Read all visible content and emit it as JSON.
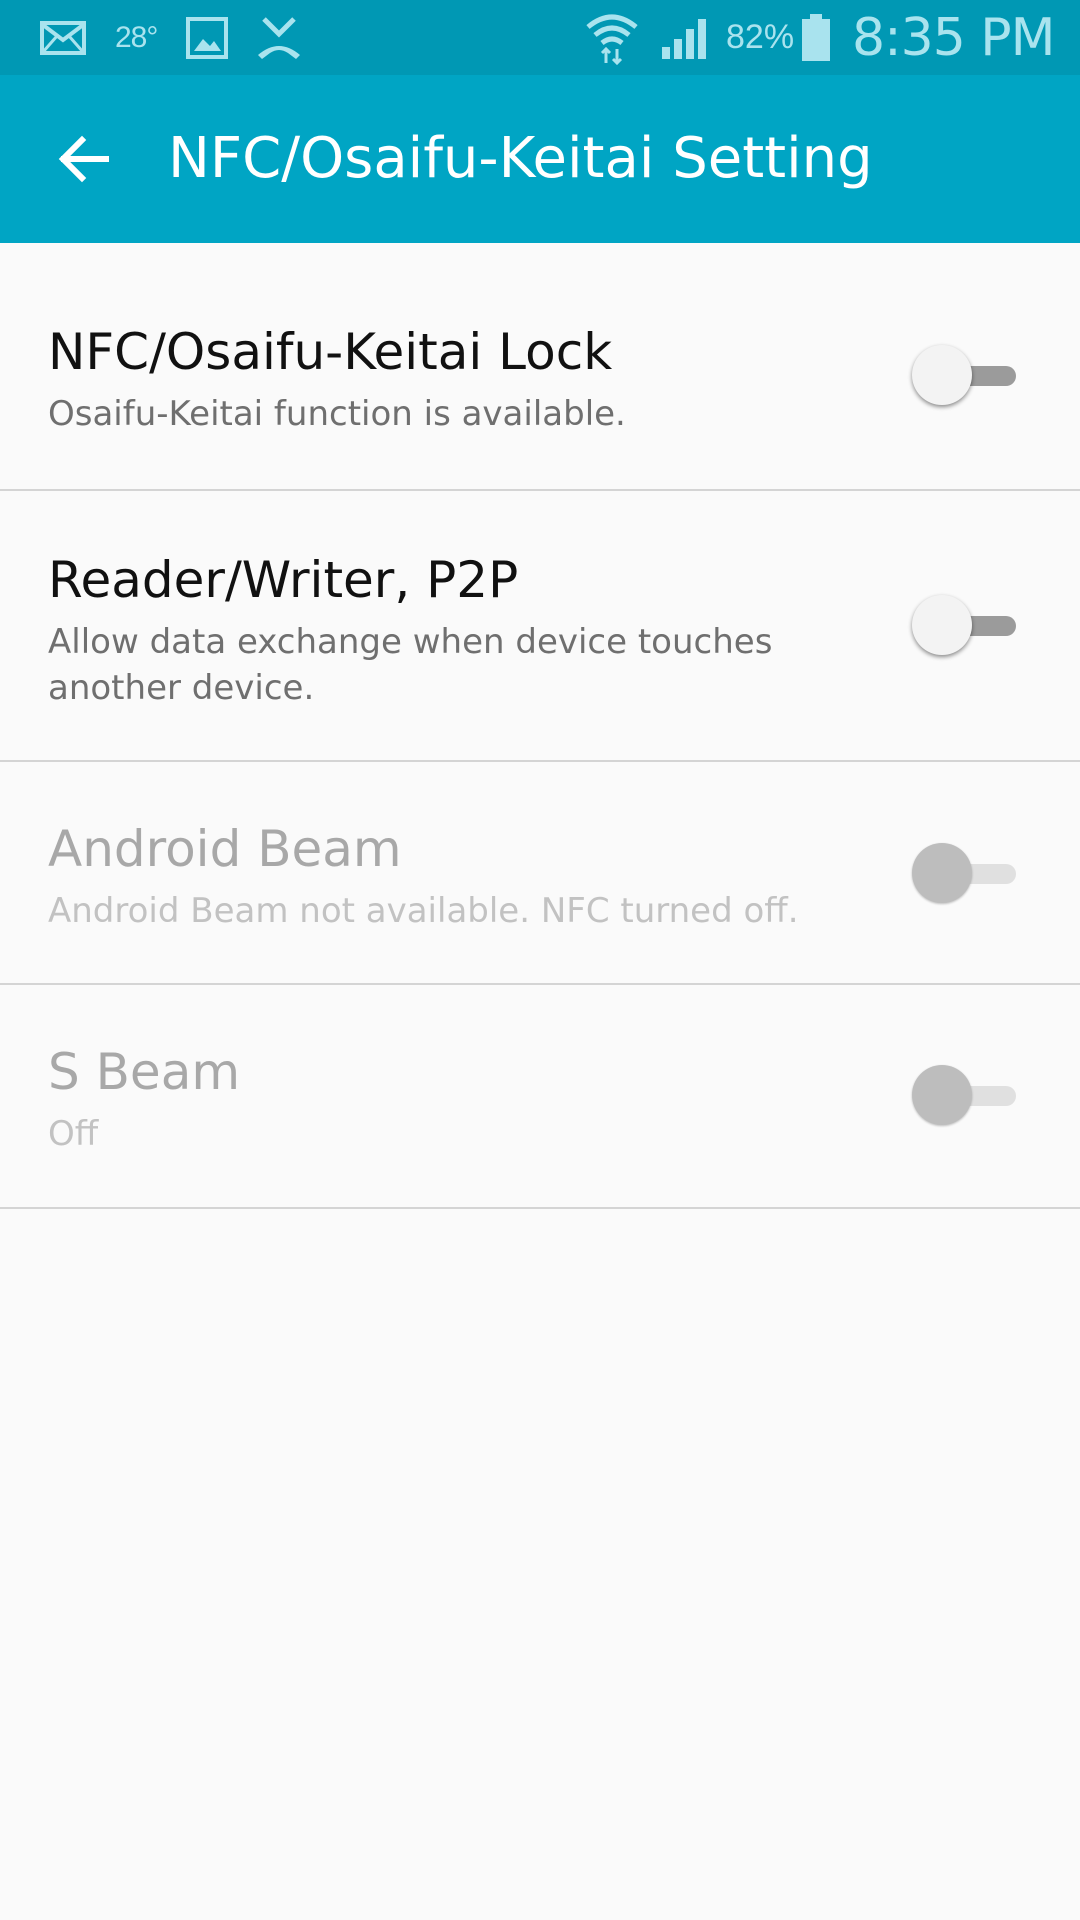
{
  "status_bar": {
    "temperature": "28°",
    "battery_percent": "82%",
    "time": "8:35 PM",
    "icons": [
      "mail-icon",
      "gallery-icon",
      "missed-call-icon",
      "wifi-icon",
      "signal-icon",
      "battery-icon"
    ]
  },
  "app_bar": {
    "title": "NFC/Osaifu-Keitai Setting",
    "back_icon": "arrow-left-icon"
  },
  "settings": [
    {
      "title": "NFC/Osaifu-Keitai Lock",
      "summary": "Osaifu-Keitai function is available.",
      "enabled": true,
      "checked": false
    },
    {
      "title": "Reader/Writer, P2P",
      "summary": "Allow data exchange when device touches another device.",
      "enabled": true,
      "checked": false
    },
    {
      "title": "Android Beam",
      "summary": "Android Beam not available. NFC turned off.",
      "enabled": false,
      "checked": false
    },
    {
      "title": "S Beam",
      "summary": "Off",
      "enabled": false,
      "checked": false
    }
  ],
  "colors": {
    "status_bar": "#0098b4",
    "app_bar": "#00a5c4",
    "background": "#fafafa"
  }
}
